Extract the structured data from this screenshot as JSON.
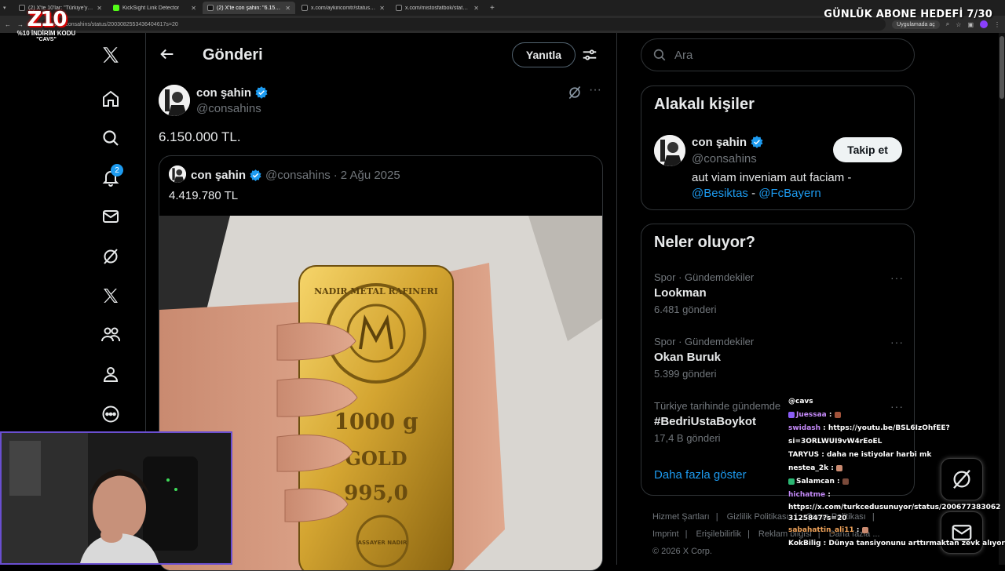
{
  "browser": {
    "tabs": [
      {
        "label": "(2) X'te 10'lar: \"Türkiye'yi ziyare..."
      },
      {
        "label": "KickSight Link Detector"
      },
      {
        "label": "(2) X'te con şahin: \"6.150.000 TL\""
      },
      {
        "label": "x.com/aykiricomtr/status/2007..."
      },
      {
        "label": "x.com/mistosfatbok/status/200..."
      }
    ],
    "url": "x.com/consahins/status/2003082553436404617s=20",
    "app_button": "Uygulamada aç"
  },
  "overlay": {
    "logo_mark": "Z10",
    "logo_sub": "%10 İNDİRİM KODU",
    "logo_code": "\"CAVS\"",
    "sub_goal": "GÜNLÜK ABONE HEDEFİ 7/30"
  },
  "nav": {
    "notification_count": "2"
  },
  "main": {
    "title": "Gönderi",
    "reply_label": "Yanıtla",
    "post": {
      "author_name": "con şahin",
      "author_handle": "@consahins",
      "text": "6.150.000 TL."
    },
    "quote": {
      "author_name": "con şahin",
      "author_handle": "@consahins",
      "date": "2 Ağu 2025",
      "separator": "·",
      "text": "4.419.780 TL"
    }
  },
  "right": {
    "search_placeholder": "Ara",
    "people": {
      "title": "Alakalı kişiler",
      "name": "con şahin",
      "handle": "@consahins",
      "follow_label": "Takip et",
      "bio_text": "aut viam inveniam aut faciam -",
      "bio_link1": "@Besiktas",
      "bio_dash": " - ",
      "bio_link2": "@FcBayern"
    },
    "trends": {
      "title": "Neler oluyor?",
      "items": [
        {
          "meta": "Spor · Gündemdekiler",
          "name": "Lookman",
          "count": "6.481 gönderi"
        },
        {
          "meta": "Spor · Gündemdekiler",
          "name": "Okan Buruk",
          "count": "5.399 gönderi"
        },
        {
          "meta": "Türkiye tarihinde gündemde",
          "name": "#BedriUstaBoykot",
          "count": "17,4 B gönderi"
        }
      ],
      "show_more": "Daha fazla göster"
    },
    "footer": {
      "links": [
        "Hizmet Şartları",
        "Gizlilik Politikası",
        "Çerez Politikası",
        "Imprint",
        "Erişilebilirlik",
        "Reklam bilgisi",
        "Daha fazla ..."
      ],
      "copyright": "© 2026 X Corp."
    }
  },
  "chat": [
    {
      "user": "@cavs",
      "message": "",
      "color": "#ffffff"
    },
    {
      "user": "Juessaa",
      "message": " : ",
      "color": "#c58af9"
    },
    {
      "user": "swidash",
      "message": " : https://youtu.be/BSL6IzOhfEE?",
      "color": "#c58af9"
    },
    {
      "user": "",
      "message": "si=3ORLWUI9vW4rEoEL",
      "color": "#ffffff"
    },
    {
      "user": "TARYUS",
      "message": " : daha ne istiyolar harbi mk",
      "color": "#ffffff"
    },
    {
      "user": "nestea_2k",
      "message": " : ",
      "color": "#ffffff"
    },
    {
      "user": "Salamcan",
      "message": " : ",
      "color": "#ffffff"
    },
    {
      "user": "hichatme",
      "message": " :",
      "color": "#c58af9"
    },
    {
      "user": "",
      "message": "https://x.com/turkcedusunuyor/status/2006773830623125847?s=20",
      "color": "#ffffff"
    },
    {
      "user": "sabahattin_ali11",
      "message": " : ",
      "color": "#f0a35a"
    },
    {
      "user": "KokBilig",
      "message": " : Dünya tansiyonunu arttırmaktan zevk alıyor",
      "color": "#ffffff"
    }
  ],
  "photo": {
    "bar_brand": "NADIR METAL RAFINERI",
    "bar_weight": "1000 g",
    "bar_metal": "GOLD",
    "bar_purity": "995,0",
    "bar_assayer": "ASSAYER NADIR"
  },
  "colors": {
    "accent": "#1d9bf0",
    "background": "#000000",
    "border": "#2f3336",
    "muted_text": "#71767b",
    "gold": "#d4a531"
  }
}
